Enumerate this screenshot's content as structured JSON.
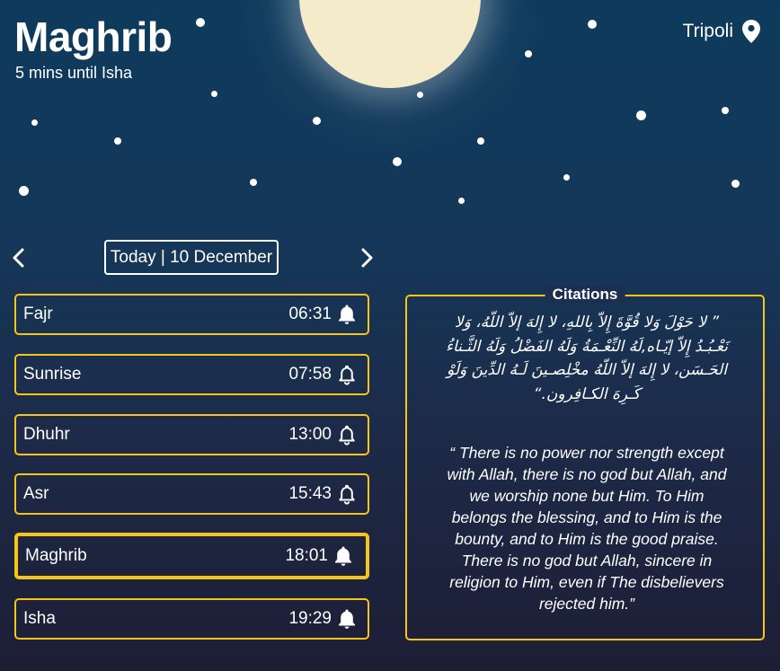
{
  "header": {
    "prayer_title": "Maghrib",
    "countdown": "5 mins until Isha",
    "location": "Tripoli"
  },
  "date_nav": {
    "label": "Today | 10 December"
  },
  "prayers": [
    {
      "name": "Fajr",
      "time": "06:31",
      "active": false
    },
    {
      "name": "Sunrise",
      "time": "07:58",
      "active": false
    },
    {
      "name": "Dhuhr",
      "time": "13:00",
      "active": false
    },
    {
      "name": "Asr",
      "time": "15:43",
      "active": false
    },
    {
      "name": "Maghrib",
      "time": "18:01",
      "active": true
    },
    {
      "name": "Isha",
      "time": "19:29",
      "active": false
    }
  ],
  "citations": {
    "title": "Citations",
    "arabic": "” لا حَوْلَ وَلا قُوَّةَ إِلاّ بِاللهِ، لا إِلهَ إلاّ اللّهُ، وَلا نَعْـبُـدُ إِلاّ إيّـاه,لَهُ النِّعْـمَةُ وَلَهُ الفَضْلُ وَلَهُ الثَّـناءُ الحَـسَن، لا إِلهَ إلاّ اللّهُ مخْلِصـينَ لَـهُ الدِّينَ وَلَوْ كَـرِهَ الكـافِرون.“",
    "english": "“ There is no power nor strength except with Allah, there is no god but Allah, and we worship none but Him. To Him belongs the blessing, and to Him is the bounty, and to Him is the good praise. There is no god but Allah, sincere in religion to Him, even if The disbelievers rejected him.”"
  },
  "colors": {
    "accent": "#f5c518",
    "moon": "#f3ebc9"
  }
}
